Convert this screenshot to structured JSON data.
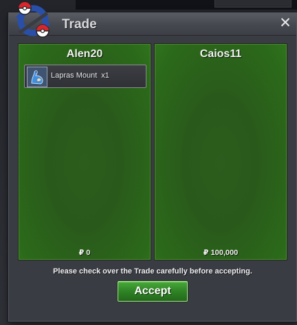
{
  "window": {
    "title": "Trade",
    "close_glyph": "✕"
  },
  "trade": {
    "left": {
      "name": "Alen20",
      "items": [
        {
          "icon": "lapras-icon",
          "label": "Lapras Mount",
          "qty": "x1"
        }
      ],
      "money": "₽ 0"
    },
    "right": {
      "name": "Caios11",
      "items": [],
      "money": "₽ 100,000"
    }
  },
  "footer": {
    "notice": "Please check over the Trade carefully before accepting.",
    "accept_label": "Accept"
  },
  "colors": {
    "panel_green": "#2d5d1d",
    "accept_green": "#2f8325",
    "window_gray": "#3a3c43"
  }
}
